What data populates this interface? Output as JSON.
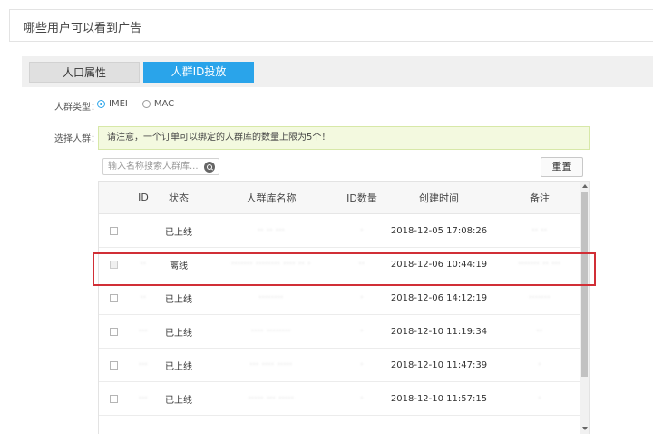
{
  "header": {
    "title": "哪些用户可以看到广告"
  },
  "tabs": [
    {
      "label": "人口属性",
      "active": false
    },
    {
      "label": "人群ID投放",
      "active": true
    }
  ],
  "form": {
    "crowd_type_label": "人群类型：",
    "crowd_type_options": [
      {
        "label": "IMEI",
        "checked": true
      },
      {
        "label": "MAC",
        "checked": false
      }
    ],
    "select_crowd_label": "选择人群：",
    "notice": "请注意，一个订单可以绑定的人群库的数量上限为5个！",
    "search_placeholder": "输入名称搜索人群库...",
    "reset_label": "重置"
  },
  "table": {
    "columns": [
      "",
      "ID",
      "状态",
      "人群库名称",
      "ID数量",
      "创建时间",
      "备注"
    ],
    "rows": [
      {
        "id": "",
        "status": "已上线",
        "name": "·· ·· ···",
        "count": "·",
        "time": "2018-12-05 17:08:26",
        "note": "·· ··",
        "disabled": false
      },
      {
        "id": "··",
        "status": "离线",
        "name": "······· ········ ···· ·· ·",
        "count": "··",
        "time": "2018-12-06 10:44:19",
        "note": "······· ·· ···",
        "disabled": true
      },
      {
        "id": "··",
        "status": "已上线",
        "name": "········",
        "count": "·",
        "time": "2018-12-06 14:12:19",
        "note": "·······",
        "disabled": false
      },
      {
        "id": "···",
        "status": "已上线",
        "name": "···· ········",
        "count": "·",
        "time": "2018-12-10 11:19:34",
        "note": "··",
        "disabled": false
      },
      {
        "id": "···",
        "status": "已上线",
        "name": "··· ···· ·····",
        "count": "·",
        "time": "2018-12-10 11:47:39",
        "note": "·",
        "disabled": false
      },
      {
        "id": "···",
        "status": "已上线",
        "name": "····· ··· ·····",
        "count": "·",
        "time": "2018-12-10 11:57:15",
        "note": "·",
        "disabled": false
      }
    ]
  },
  "colors": {
    "accent": "#2aa4ea",
    "highlight": "#d12f36",
    "notice_bg": "#f3f9df"
  }
}
